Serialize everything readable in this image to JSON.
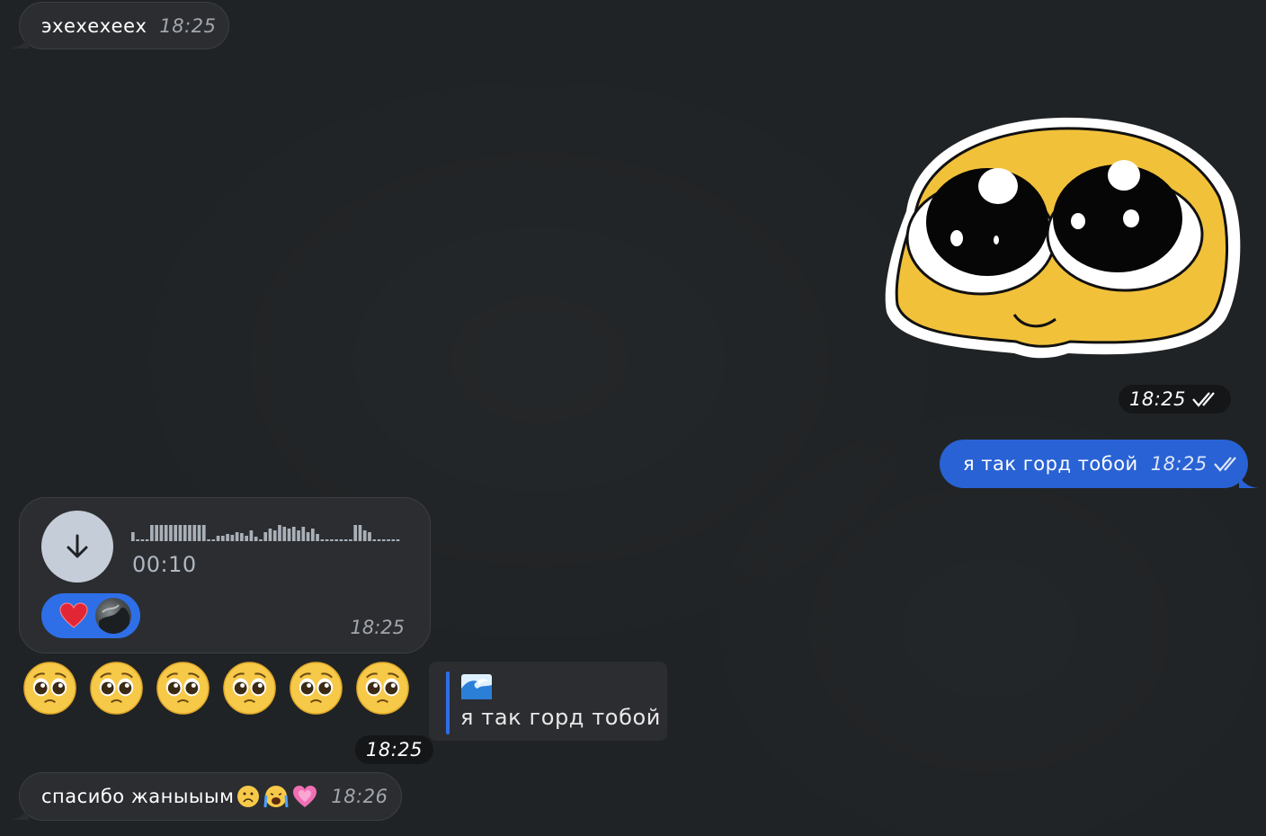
{
  "colors": {
    "background": "#202325",
    "incoming_bubble": "#2b2d31",
    "outgoing_bubble": "#2962d4",
    "reaction_pill": "#2e6fe8",
    "reply_accent": "#2f6ee6"
  },
  "messages": {
    "m1": {
      "text": "эхехехеех",
      "time": "18:25"
    },
    "sticker": {
      "icon": "pleading-face-sticker",
      "time": "18:25",
      "status": "read"
    },
    "m2": {
      "text": "я так горд тобой",
      "time": "18:25",
      "status": "read"
    },
    "voice": {
      "duration": "00:10",
      "time": "18:25",
      "reaction": "heart-emoji"
    },
    "emojis": {
      "count": 6,
      "icon": "pleading-face-emoji",
      "time": "18:25"
    },
    "reply": {
      "icon": "water-wave-emoji",
      "text": "я так горд тобой"
    },
    "m3": {
      "text": "спасибо жаныыым",
      "emojis": [
        "frowning-face-emoji",
        "crying-face-emoji",
        "growing-heart-emoji"
      ],
      "time": "18:26"
    }
  }
}
